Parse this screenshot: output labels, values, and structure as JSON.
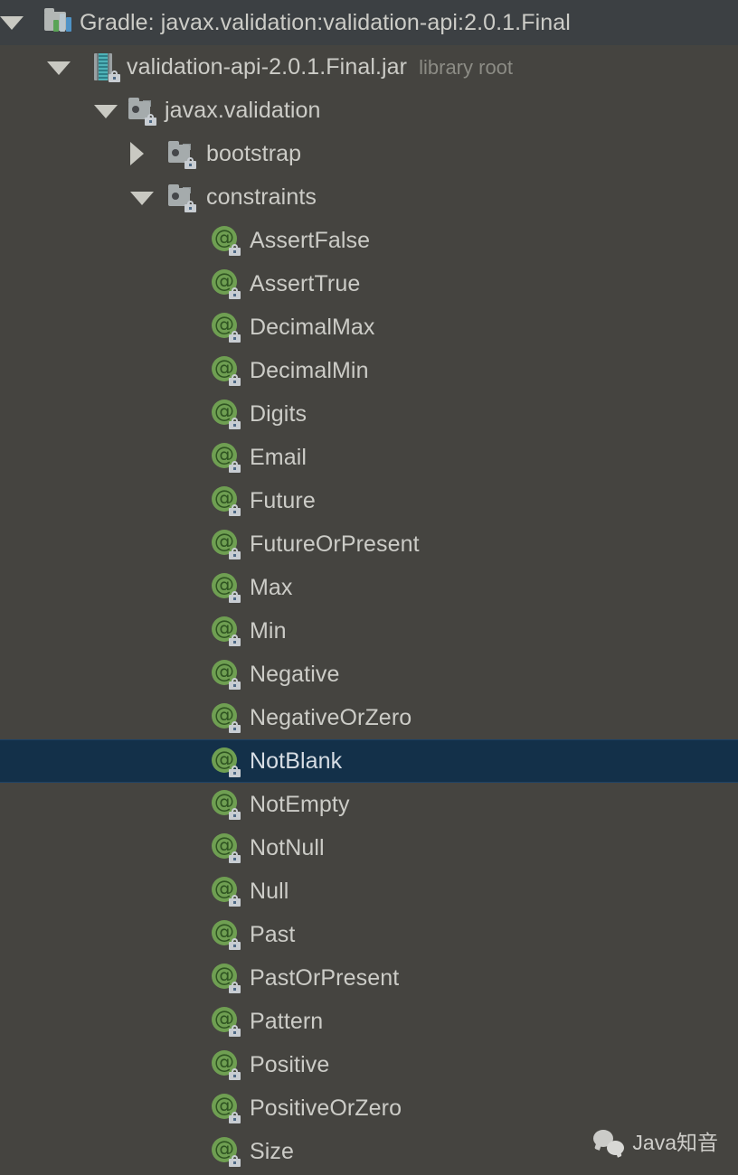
{
  "window": {
    "background_color": "#454440",
    "header_background_color": "#3c4043",
    "selected_row_color": "#133049",
    "text_color": "#ccccc7",
    "muted_text_color": "#8c8c85",
    "annotation_icon_color": "#6f9f52"
  },
  "tree": {
    "nodes": [
      {
        "label": "Gradle: javax.validation:validation-api:2.0.1.Final",
        "sublabel": "",
        "icon": "gradle-library-icon",
        "twisty": "down",
        "depth": 0,
        "selected": false,
        "header": true
      },
      {
        "label": "validation-api-2.0.1.Final.jar",
        "sublabel": "library root",
        "icon": "jar-archive-icon",
        "twisty": "down",
        "depth": 1,
        "selected": false,
        "header": false
      },
      {
        "label": "javax.validation",
        "sublabel": "",
        "icon": "package-folder-icon",
        "twisty": "down",
        "depth": 2,
        "selected": false,
        "header": false
      },
      {
        "label": "bootstrap",
        "sublabel": "",
        "icon": "package-folder-icon",
        "twisty": "right",
        "depth": 3,
        "selected": false,
        "header": false
      },
      {
        "label": "constraints",
        "sublabel": "",
        "icon": "package-folder-icon",
        "twisty": "down",
        "depth": 3,
        "selected": false,
        "header": false
      },
      {
        "label": "AssertFalse",
        "sublabel": "",
        "icon": "annotation-icon",
        "twisty": "none",
        "depth": 4,
        "selected": false,
        "header": false
      },
      {
        "label": "AssertTrue",
        "sublabel": "",
        "icon": "annotation-icon",
        "twisty": "none",
        "depth": 4,
        "selected": false,
        "header": false
      },
      {
        "label": "DecimalMax",
        "sublabel": "",
        "icon": "annotation-icon",
        "twisty": "none",
        "depth": 4,
        "selected": false,
        "header": false
      },
      {
        "label": "DecimalMin",
        "sublabel": "",
        "icon": "annotation-icon",
        "twisty": "none",
        "depth": 4,
        "selected": false,
        "header": false
      },
      {
        "label": "Digits",
        "sublabel": "",
        "icon": "annotation-icon",
        "twisty": "none",
        "depth": 4,
        "selected": false,
        "header": false
      },
      {
        "label": "Email",
        "sublabel": "",
        "icon": "annotation-icon",
        "twisty": "none",
        "depth": 4,
        "selected": false,
        "header": false
      },
      {
        "label": "Future",
        "sublabel": "",
        "icon": "annotation-icon",
        "twisty": "none",
        "depth": 4,
        "selected": false,
        "header": false
      },
      {
        "label": "FutureOrPresent",
        "sublabel": "",
        "icon": "annotation-icon",
        "twisty": "none",
        "depth": 4,
        "selected": false,
        "header": false
      },
      {
        "label": "Max",
        "sublabel": "",
        "icon": "annotation-icon",
        "twisty": "none",
        "depth": 4,
        "selected": false,
        "header": false
      },
      {
        "label": "Min",
        "sublabel": "",
        "icon": "annotation-icon",
        "twisty": "none",
        "depth": 4,
        "selected": false,
        "header": false
      },
      {
        "label": "Negative",
        "sublabel": "",
        "icon": "annotation-icon",
        "twisty": "none",
        "depth": 4,
        "selected": false,
        "header": false
      },
      {
        "label": "NegativeOrZero",
        "sublabel": "",
        "icon": "annotation-icon",
        "twisty": "none",
        "depth": 4,
        "selected": false,
        "header": false
      },
      {
        "label": "NotBlank",
        "sublabel": "",
        "icon": "annotation-icon",
        "twisty": "none",
        "depth": 4,
        "selected": true,
        "header": false
      },
      {
        "label": "NotEmpty",
        "sublabel": "",
        "icon": "annotation-icon",
        "twisty": "none",
        "depth": 4,
        "selected": false,
        "header": false
      },
      {
        "label": "NotNull",
        "sublabel": "",
        "icon": "annotation-icon",
        "twisty": "none",
        "depth": 4,
        "selected": false,
        "header": false
      },
      {
        "label": "Null",
        "sublabel": "",
        "icon": "annotation-icon",
        "twisty": "none",
        "depth": 4,
        "selected": false,
        "header": false
      },
      {
        "label": "Past",
        "sublabel": "",
        "icon": "annotation-icon",
        "twisty": "none",
        "depth": 4,
        "selected": false,
        "header": false
      },
      {
        "label": "PastOrPresent",
        "sublabel": "",
        "icon": "annotation-icon",
        "twisty": "none",
        "depth": 4,
        "selected": false,
        "header": false
      },
      {
        "label": "Pattern",
        "sublabel": "",
        "icon": "annotation-icon",
        "twisty": "none",
        "depth": 4,
        "selected": false,
        "header": false
      },
      {
        "label": "Positive",
        "sublabel": "",
        "icon": "annotation-icon",
        "twisty": "none",
        "depth": 4,
        "selected": false,
        "header": false
      },
      {
        "label": "PositiveOrZero",
        "sublabel": "",
        "icon": "annotation-icon",
        "twisty": "none",
        "depth": 4,
        "selected": false,
        "header": false
      },
      {
        "label": "Size",
        "sublabel": "",
        "icon": "annotation-icon",
        "twisty": "none",
        "depth": 4,
        "selected": false,
        "header": false
      }
    ]
  },
  "watermark": {
    "text": "Java知音",
    "icon": "wechat-icon"
  }
}
